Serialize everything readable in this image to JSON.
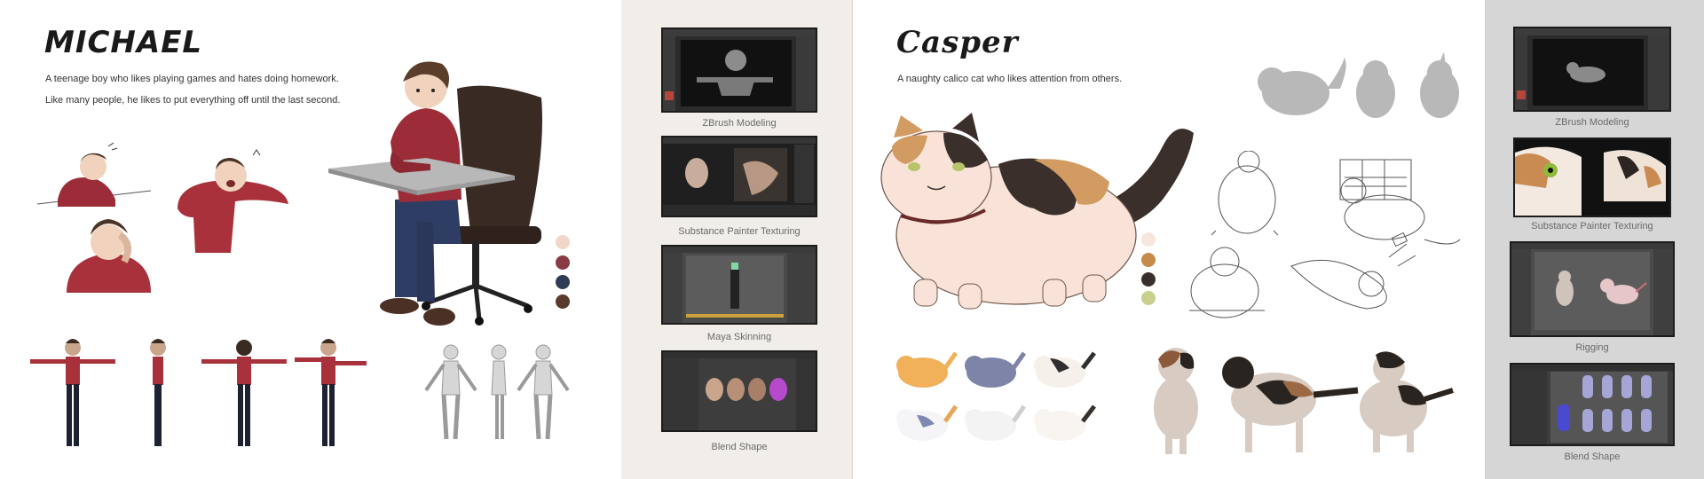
{
  "michael": {
    "name": "MICHAEL",
    "description_line1": "A teenage boy who likes playing games and hates doing homework.",
    "description_line2": "Like many people, he likes to put everything off until the last second.",
    "palette": [
      "#f2d6c8",
      "#8a3a42",
      "#2f3b55",
      "#5a3a2c"
    ],
    "workflow": [
      {
        "caption": "ZBrush Modeling"
      },
      {
        "caption": "Substance Painter Texturing"
      },
      {
        "caption": "Maya Skinning"
      },
      {
        "caption": "Blend Shape"
      }
    ]
  },
  "casper": {
    "name": "Casper",
    "description": "A naughty calico cat who likes attention from others.",
    "palette": [
      "#f7e6de",
      "#c68a4b",
      "#3a302b",
      "#c9d08c"
    ],
    "workflow": [
      {
        "caption": "ZBrush Modeling"
      },
      {
        "caption": "Substance Painter Texturing"
      },
      {
        "caption": "Rigging"
      },
      {
        "caption": "Blend Shape"
      }
    ]
  }
}
